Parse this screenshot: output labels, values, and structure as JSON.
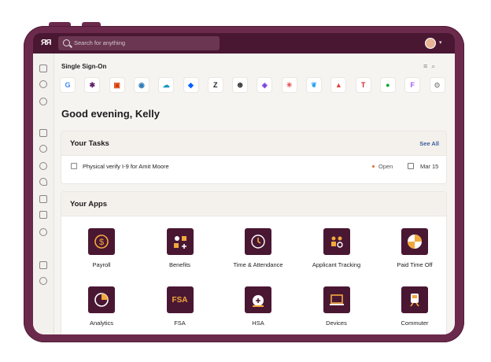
{
  "search": {
    "placeholder": "Search for anything"
  },
  "sso": {
    "title": "Single Sign-On",
    "apps": [
      {
        "icon": "google-icon",
        "glyph": "G",
        "color": "#4285f4"
      },
      {
        "icon": "slack-icon",
        "glyph": "✱",
        "color": "#611f69"
      },
      {
        "icon": "office-icon",
        "glyph": "▣",
        "color": "#d83b01"
      },
      {
        "icon": "webex-icon",
        "glyph": "◉",
        "color": "#2a7ab7"
      },
      {
        "icon": "salesforce-icon",
        "glyph": "☁",
        "color": "#1798c1"
      },
      {
        "icon": "dropbox-icon",
        "glyph": "◆",
        "color": "#0061ff"
      },
      {
        "icon": "zendesk-icon",
        "glyph": "Z",
        "color": "#222"
      },
      {
        "icon": "medium-icon",
        "glyph": "⊛",
        "color": "#111"
      },
      {
        "icon": "notion-icon",
        "glyph": "◈",
        "color": "#7b3fe4"
      },
      {
        "icon": "asterisk-icon",
        "glyph": "✳",
        "color": "#e54b4b"
      },
      {
        "icon": "twitter-icon",
        "glyph": "❦",
        "color": "#1da1f2"
      },
      {
        "icon": "triangle-icon",
        "glyph": "▲",
        "color": "#e0443a"
      },
      {
        "icon": "target-icon",
        "glyph": "T",
        "color": "#d9232e"
      },
      {
        "icon": "evernote-icon",
        "glyph": "●",
        "color": "#00a82d"
      },
      {
        "icon": "figma-icon",
        "glyph": "F",
        "color": "#a259ff"
      },
      {
        "icon": "more-apps-icon",
        "glyph": "⊙",
        "color": "#777"
      }
    ]
  },
  "greeting": "Good evening, Kelly",
  "tasks": {
    "title": "Your Tasks",
    "see_all": "See All",
    "items": [
      {
        "text": "Physical verify I-9 for Amit Moore",
        "status": "Open",
        "due": "Mar 15"
      }
    ]
  },
  "apps": {
    "title": "Your Apps",
    "items": [
      {
        "label": "Payroll",
        "icon": "payroll-icon"
      },
      {
        "label": "Benefits",
        "icon": "benefits-icon"
      },
      {
        "label": "Time & Attendance",
        "icon": "clock-icon"
      },
      {
        "label": "Applicant Tracking",
        "icon": "applicants-icon"
      },
      {
        "label": "Paid Time Off",
        "icon": "beach-ball-icon"
      },
      {
        "label": "Analytics",
        "icon": "analytics-icon"
      },
      {
        "label": "FSA",
        "icon": "fsa-icon",
        "text": "FSA"
      },
      {
        "label": "HSA",
        "icon": "hsa-icon"
      },
      {
        "label": "Devices",
        "icon": "laptop-icon"
      },
      {
        "label": "Commuter",
        "icon": "train-icon"
      }
    ]
  },
  "colors": {
    "brand": "#4a1733",
    "device": "#6b2a4c",
    "accent": "#f2a93b"
  }
}
